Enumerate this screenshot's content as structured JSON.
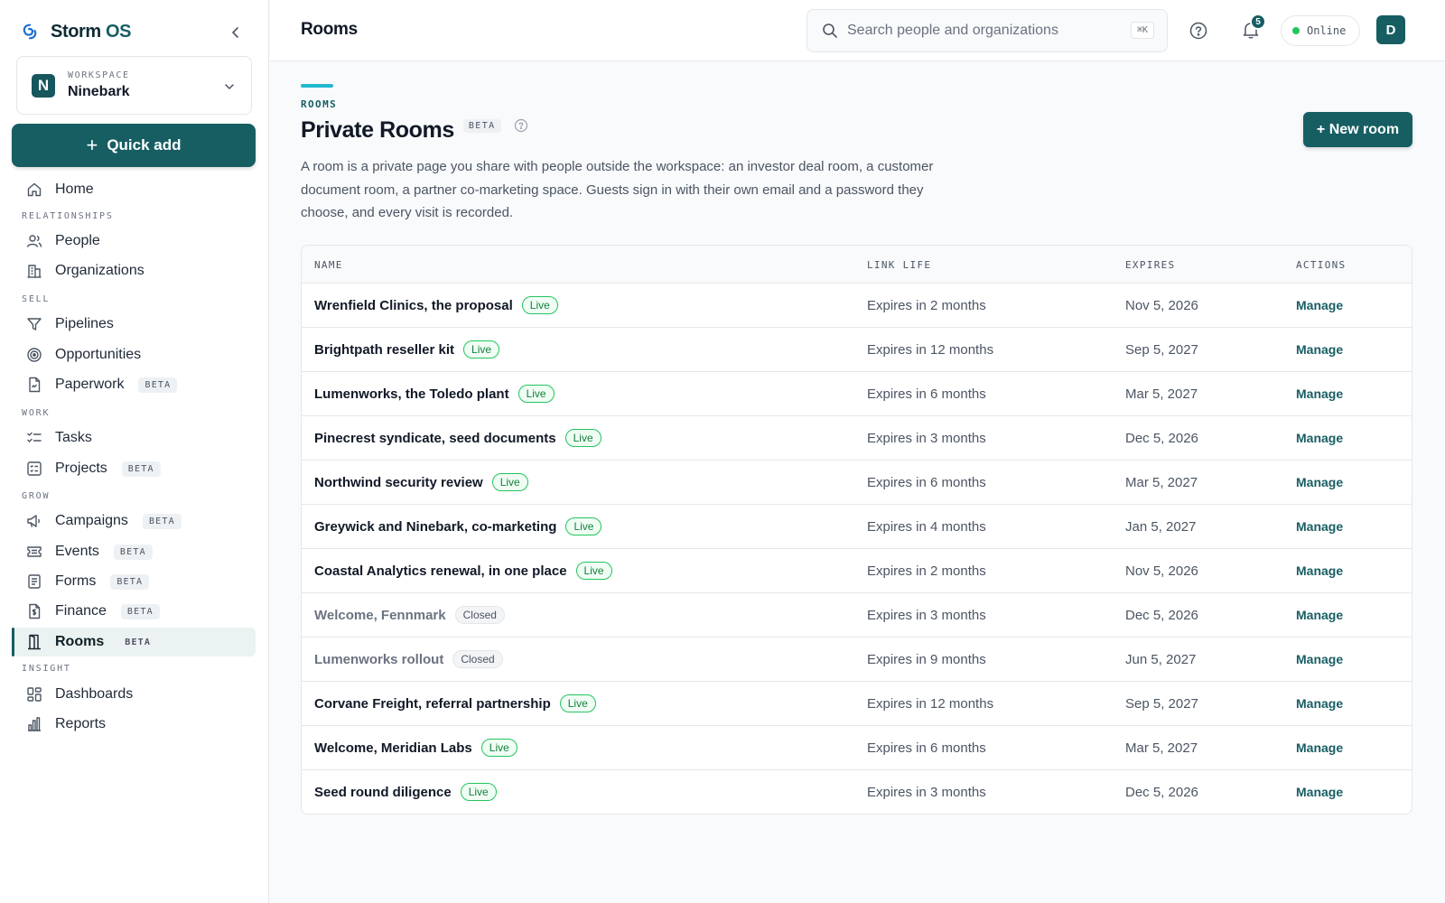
{
  "brand": {
    "name": "Storm",
    "suffix": "OS"
  },
  "workspace": {
    "label": "WORKSPACE",
    "initial": "N",
    "name": "Ninebark"
  },
  "quick_add": {
    "plus": "+",
    "label": "Quick add"
  },
  "sidebar": {
    "home": "Home",
    "sections": {
      "relationships": "RELATIONSHIPS",
      "sell": "SELL",
      "work": "WORK",
      "grow": "GROW",
      "insight": "INSIGHT"
    },
    "items": {
      "people": "People",
      "organizations": "Organizations",
      "pipelines": "Pipelines",
      "opportunities": "Opportunities",
      "paperwork": "Paperwork",
      "tasks": "Tasks",
      "projects": "Projects",
      "campaigns": "Campaigns",
      "events": "Events",
      "forms": "Forms",
      "finance": "Finance",
      "rooms": "Rooms",
      "dashboards": "Dashboards",
      "reports": "Reports"
    },
    "beta_label": "BETA"
  },
  "topbar": {
    "title": "Rooms",
    "search_placeholder": "Search people and organizations",
    "shortcut": "⌘K",
    "notifications_count": "5",
    "status": "Online",
    "avatar_initial": "D"
  },
  "main": {
    "eyebrow": "ROOMS",
    "title": "Private Rooms",
    "title_badge": "BETA",
    "description": "A room is a private page you share with people outside the workspace: an investor deal room, a customer document room, a partner co-marketing space. Guests sign in with their own email and a password they choose, and every visit is recorded.",
    "new_room_label": "+ New room"
  },
  "table": {
    "headers": {
      "name": "NAME",
      "link_life": "LINK LIFE",
      "expires": "EXPIRES",
      "actions": "ACTIONS"
    },
    "action_label": "Manage",
    "rows": [
      {
        "name": "Wrenfield Clinics, the proposal",
        "status": "Live",
        "link_life": "Expires in 2 months",
        "expires": "Nov 5, 2026"
      },
      {
        "name": "Brightpath reseller kit",
        "status": "Live",
        "link_life": "Expires in 12 months",
        "expires": "Sep 5, 2027"
      },
      {
        "name": "Lumenworks, the Toledo plant",
        "status": "Live",
        "link_life": "Expires in 6 months",
        "expires": "Mar 5, 2027"
      },
      {
        "name": "Pinecrest syndicate, seed documents",
        "status": "Live",
        "link_life": "Expires in 3 months",
        "expires": "Dec 5, 2026"
      },
      {
        "name": "Northwind security review",
        "status": "Live",
        "link_life": "Expires in 6 months",
        "expires": "Mar 5, 2027"
      },
      {
        "name": "Greywick and Ninebark, co-marketing",
        "status": "Live",
        "link_life": "Expires in 4 months",
        "expires": "Jan 5, 2027"
      },
      {
        "name": "Coastal Analytics renewal, in one place",
        "status": "Live",
        "link_life": "Expires in 2 months",
        "expires": "Nov 5, 2026"
      },
      {
        "name": "Welcome, Fennmark",
        "status": "Closed",
        "link_life": "Expires in 3 months",
        "expires": "Dec 5, 2026"
      },
      {
        "name": "Lumenworks rollout",
        "status": "Closed",
        "link_life": "Expires in 9 months",
        "expires": "Jun 5, 2027"
      },
      {
        "name": "Corvane Freight, referral partnership",
        "status": "Live",
        "link_life": "Expires in 12 months",
        "expires": "Sep 5, 2027"
      },
      {
        "name": "Welcome, Meridian Labs",
        "status": "Live",
        "link_life": "Expires in 6 months",
        "expires": "Mar 5, 2027"
      },
      {
        "name": "Seed round diligence",
        "status": "Live",
        "link_life": "Expires in 3 months",
        "expires": "Dec 5, 2026"
      }
    ]
  },
  "colors": {
    "accent": "#175e63",
    "accent_light": "#22b8cf",
    "live": "#22c55e"
  }
}
